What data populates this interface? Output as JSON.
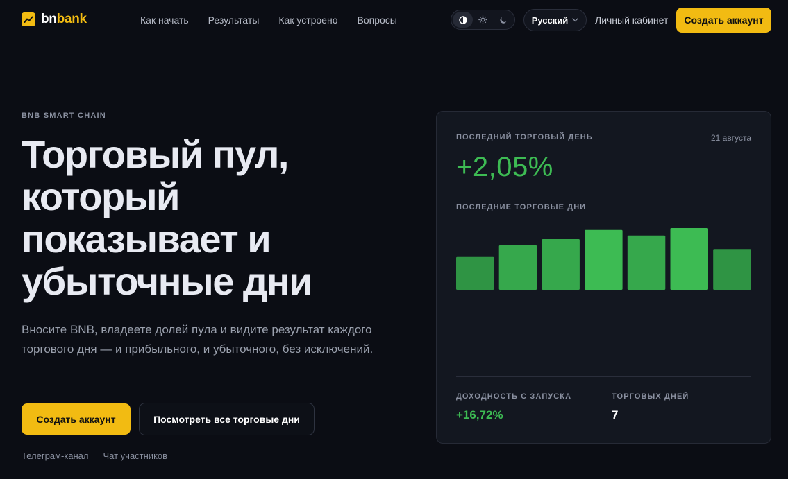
{
  "header": {
    "logo": {
      "part1": "bn",
      "part2": "bank"
    },
    "nav": [
      "Как начать",
      "Результаты",
      "Как устроено",
      "Вопросы"
    ],
    "theme": {
      "options": [
        "contrast-icon",
        "sun-icon",
        "moon-icon"
      ],
      "active": 0
    },
    "language": "Русский",
    "cabinet": "Личный кабинет",
    "cta": "Создать аккаунт"
  },
  "hero": {
    "eyebrow": "BNB SMART CHAIN",
    "title_lines": [
      "Торговый пул,",
      "который",
      "показывает и",
      "убыточные дни"
    ],
    "subtitle": "Вносите BNB, владеете долей пула и видите результат каждого торгового дня — и прибыльного, и убыточного, без исключений.",
    "cta": "Создать аккаунт",
    "secondary": "Посмотреть все торговые дни",
    "links": [
      "Телеграм-канал",
      "Чат участников"
    ]
  },
  "card": {
    "last_day_label": "ПОСЛЕДНИЙ ТОРГОВЫЙ ДЕНЬ",
    "date": "21 августа",
    "last_day_value": "+2,05%",
    "recent_label": "ПОСЛЕДНИЕ ТОРГОВЫЕ ДНИ",
    "bars": [
      0.53,
      0.72,
      0.82,
      0.97,
      0.88,
      1.0,
      0.66
    ],
    "bar_colors": [
      "#2f9444",
      "#36a84c",
      "#36a84c",
      "#3dbb53",
      "#36a84c",
      "#3dbb53",
      "#2f9444"
    ],
    "stats": [
      {
        "label": "ДОХОДНОСТЬ С ЗАПУСКА",
        "value": "+16,72%",
        "color": "#3dbb53"
      },
      {
        "label": "ТОРГОВЫХ ДНЕЙ",
        "value": "7",
        "color": "#ffffff"
      }
    ]
  }
}
